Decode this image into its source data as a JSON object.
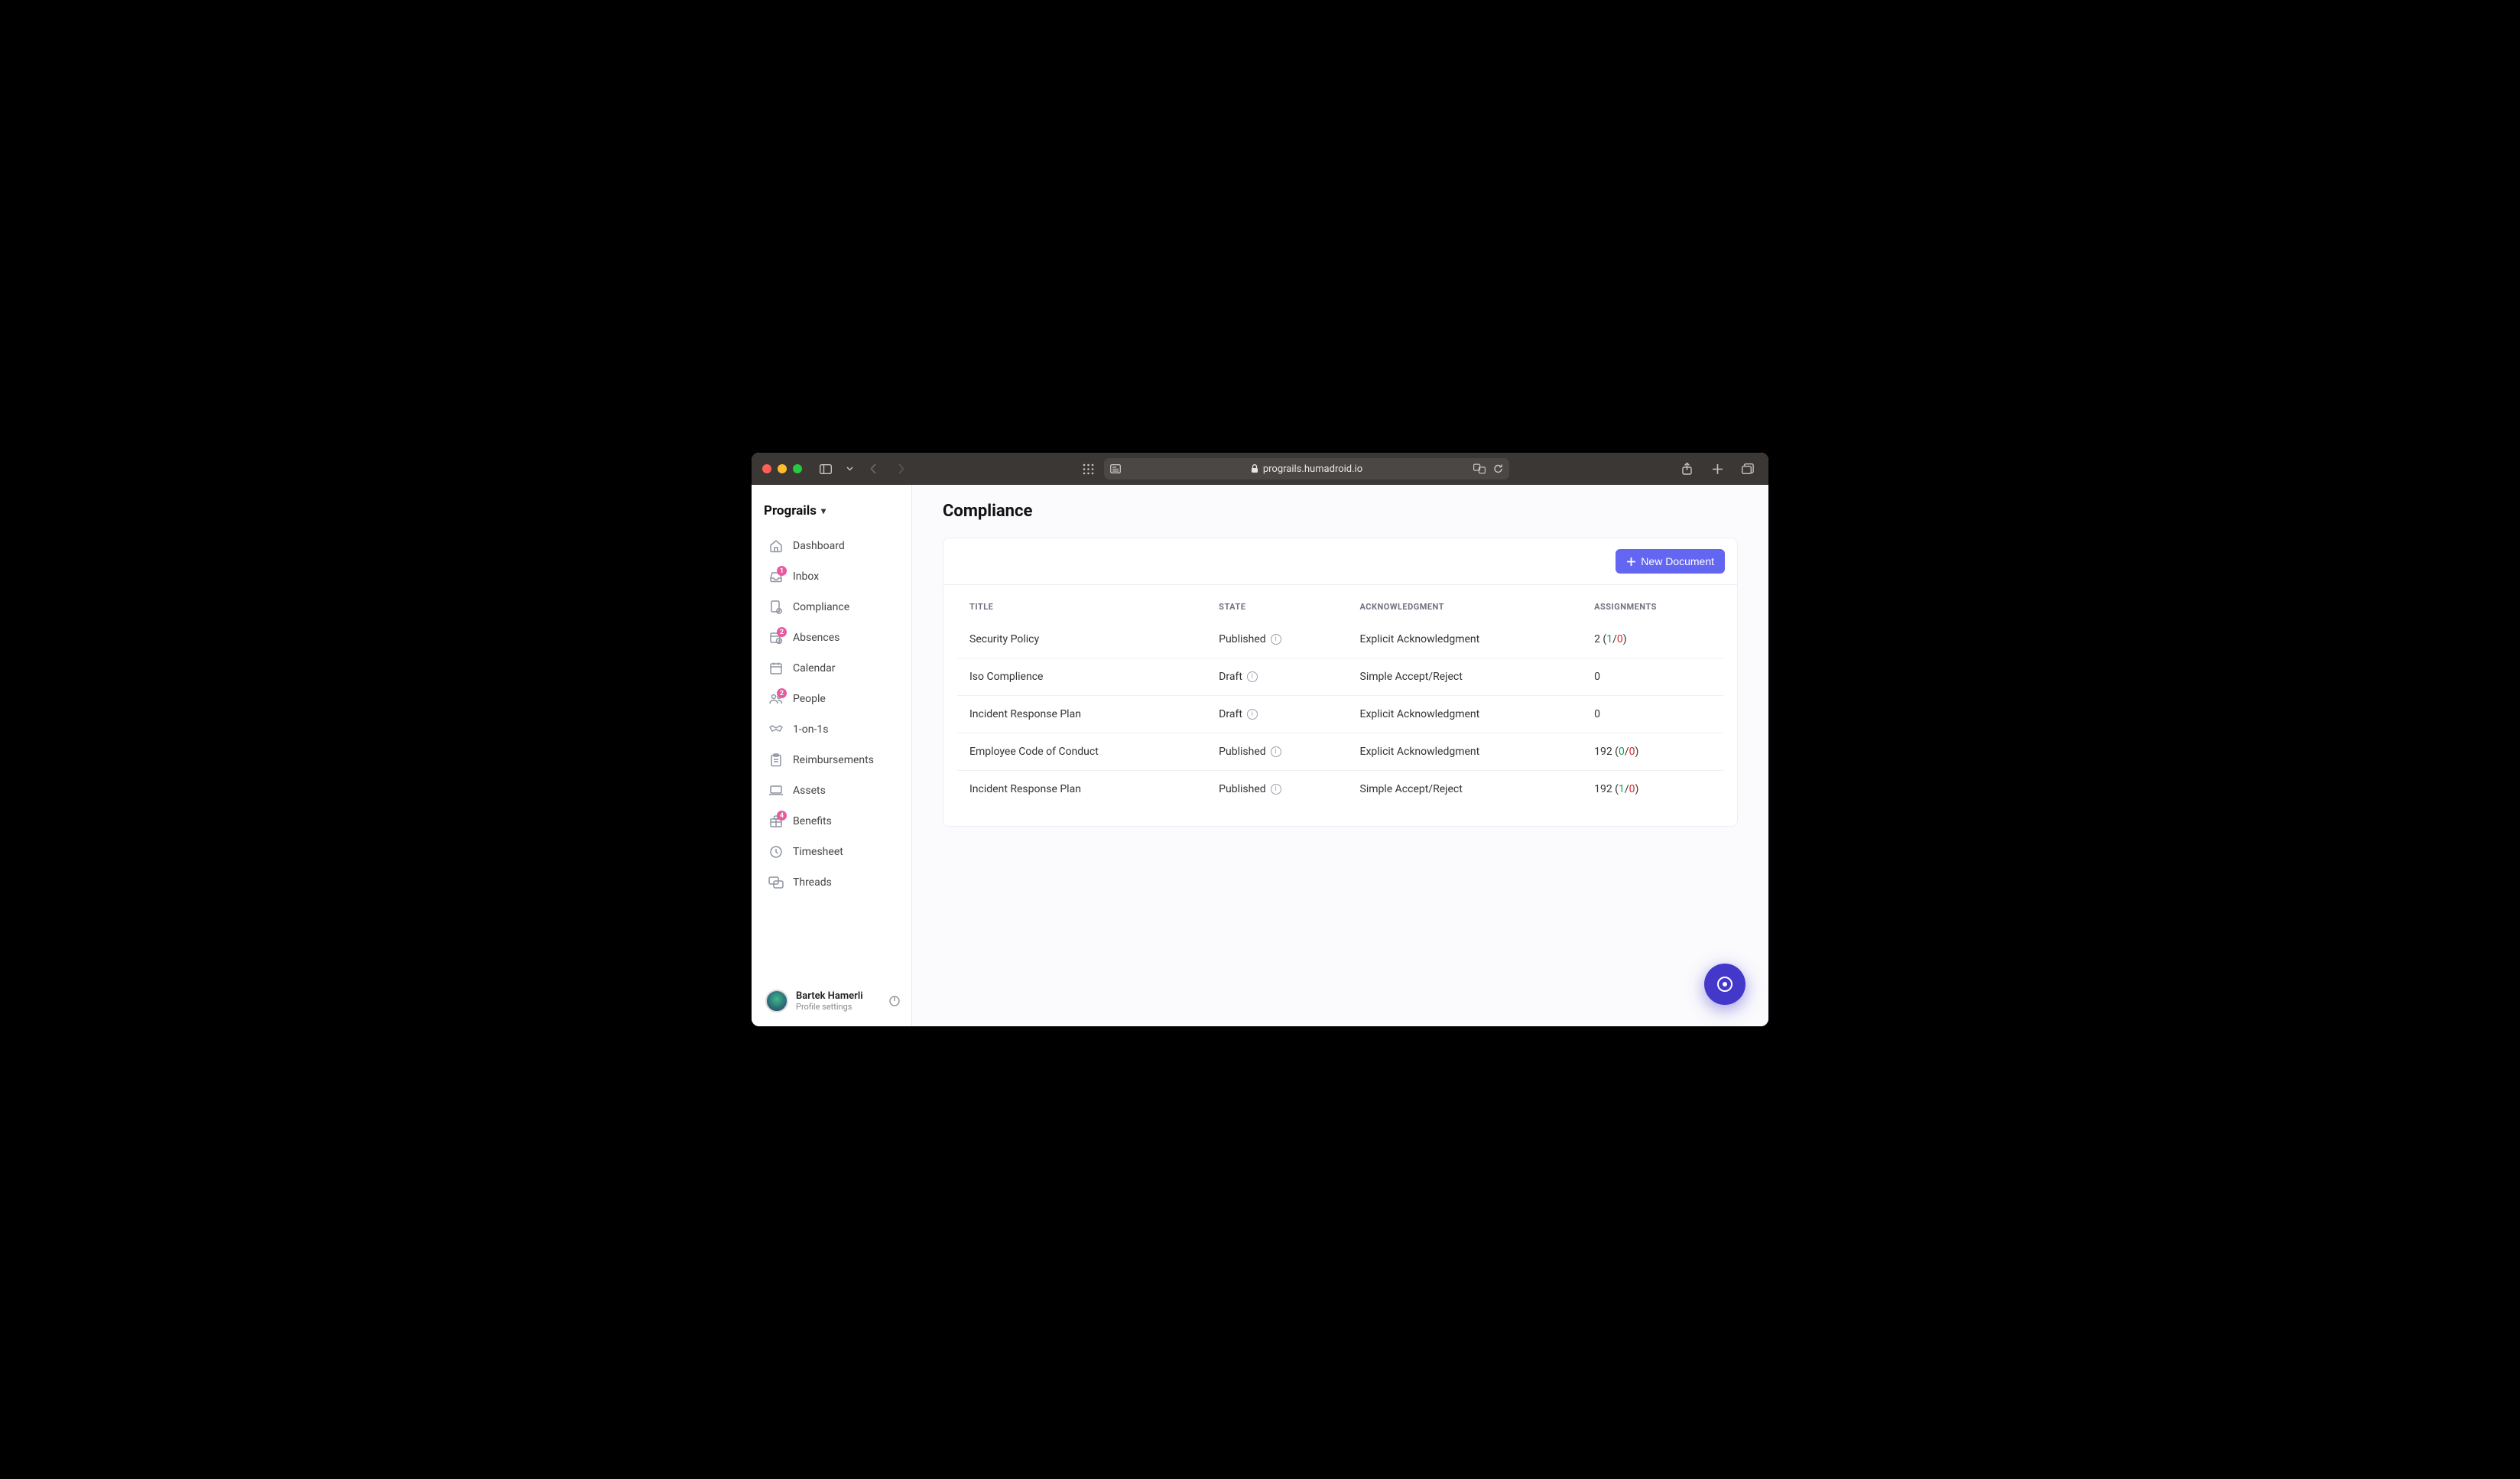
{
  "browser": {
    "url": "prograils.humadroid.io"
  },
  "org": {
    "name": "Prograils"
  },
  "sidebar": {
    "items": [
      {
        "label": "Dashboard",
        "icon": "home",
        "badge": null
      },
      {
        "label": "Inbox",
        "icon": "inbox",
        "badge": "1"
      },
      {
        "label": "Compliance",
        "icon": "compliance",
        "badge": null
      },
      {
        "label": "Absences",
        "icon": "calendar-clock",
        "badge": "2"
      },
      {
        "label": "Calendar",
        "icon": "calendar",
        "badge": null
      },
      {
        "label": "People",
        "icon": "people",
        "badge": "2"
      },
      {
        "label": "1-on-1s",
        "icon": "handshake",
        "badge": null
      },
      {
        "label": "Reimbursements",
        "icon": "clipboard",
        "badge": null
      },
      {
        "label": "Assets",
        "icon": "laptop",
        "badge": null
      },
      {
        "label": "Benefits",
        "icon": "gift",
        "badge": "4"
      },
      {
        "label": "Timesheet",
        "icon": "clock",
        "badge": null
      },
      {
        "label": "Threads",
        "icon": "chat",
        "badge": null
      }
    ]
  },
  "user": {
    "name": "Bartek Hamerli",
    "subtitle": "Profile settings"
  },
  "main": {
    "page_title": "Compliance",
    "new_document_label": "New Document",
    "columns": {
      "title": "TITLE",
      "state": "STATE",
      "ack": "ACKNOWLEDGMENT",
      "assign": "ASSIGNMENTS"
    },
    "rows": [
      {
        "title": "Security Policy",
        "state": "Published",
        "ack": "Explicit Acknowledgment",
        "assign_total": "2",
        "assign_green": "1",
        "assign_red": "0"
      },
      {
        "title": "Iso Complience",
        "state": "Draft",
        "ack": "Simple Accept/Reject",
        "assign_total": "0",
        "assign_green": null,
        "assign_red": null
      },
      {
        "title": "Incident Response Plan",
        "state": "Draft",
        "ack": "Explicit Acknowledgment",
        "assign_total": "0",
        "assign_green": null,
        "assign_red": null
      },
      {
        "title": "Employee Code of Conduct",
        "state": "Published",
        "ack": "Explicit Acknowledgment",
        "assign_total": "192",
        "assign_green": "0",
        "assign_red": "0"
      },
      {
        "title": "Incident Response Plan",
        "state": "Published",
        "ack": "Simple Accept/Reject",
        "assign_total": "192",
        "assign_green": "1",
        "assign_red": "0"
      }
    ]
  }
}
